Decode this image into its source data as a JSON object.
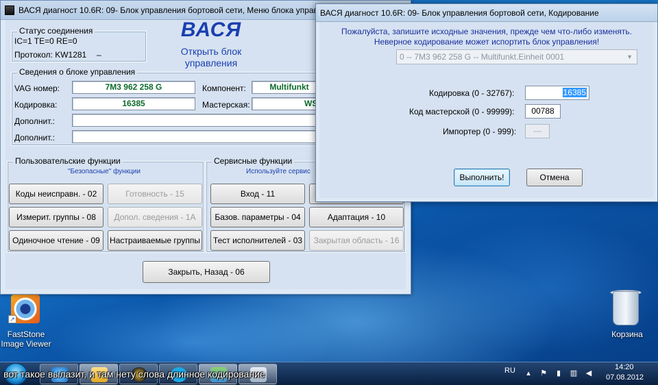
{
  "main_window": {
    "title": "ВАСЯ диагност 10.6R: 09- Блок управления бортовой сети,   Меню блока управления",
    "brand": "ВАСЯ",
    "brand_sub": "Открыть блок управления",
    "connection": {
      "title": "Статус соединения",
      "line1": "IC=1  TE=0   RE=0",
      "protocol": "Протокол: KW1281",
      "protocol_extra": "–"
    },
    "info": {
      "title": "Сведения о блоке управления",
      "vag_label": "VAG номер:",
      "vag_value": "7M3 962 258 G",
      "coding_label": "Кодировка:",
      "coding_value": "16385",
      "extra1_label": "Дополнит.:",
      "extra2_label": "Дополнит.:",
      "component_label": "Компонент:",
      "component_value": "Multifunkt",
      "workshop_label": "Мастерская:",
      "workshop_value": "WSC"
    },
    "user_functions": {
      "title": "Пользовательские функции",
      "hint": "\"Безопасные\" функции",
      "buttons": [
        "Коды неисправн. - 02",
        "Готовность - 15",
        "Измерит. группы - 08",
        "Допол. сведения - 1A",
        "Одиночное чтение - 09",
        "Настраиваемые группы"
      ]
    },
    "service_functions": {
      "title": "Сервисные функции",
      "hint": "Используйте сервис",
      "buttons": [
        "Вход - 11",
        "Базов. параметры - 04",
        "Адаптация - 10",
        "Тест исполнителей - 03",
        "Закрытая область - 16"
      ]
    },
    "close_button": "Закрыть, Назад - 06"
  },
  "dialog": {
    "title": "ВАСЯ диагност 10.6R: 09- Блок управления бортовой сети,  Кодирование",
    "warning1": "Пожалуйста, запишите исходные значения, прежде чем что-либо изменять.",
    "warning2": "Неверное кодирование может испортить блок управления!",
    "module_select": "0 -- 7M3 962 258 G -- Multifunkt.Einheit   0001",
    "coding_label": "Кодировка (0 - 32767):",
    "coding_value": "16385",
    "workshop_label": "Код мастерской (0 - 99999):",
    "workshop_value": "00788",
    "importer_label": "Импортер (0 - 999):",
    "importer_value": "---",
    "ok_button": "Выполнить!",
    "cancel_button": "Отмена"
  },
  "desktop": {
    "faststone_label": "FastStone Image Viewer",
    "recycle_label": "Корзина"
  },
  "taskbar": {
    "caption": "вот такое вылазит, и там нету слова длинное кодирование",
    "language": "RU",
    "time": "14:20",
    "date": "07.08.2012"
  }
}
